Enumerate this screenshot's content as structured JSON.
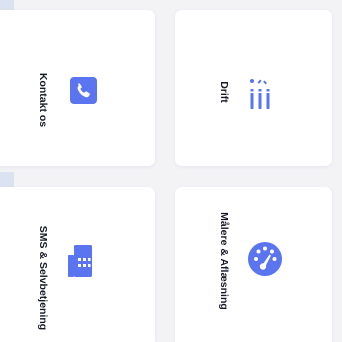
{
  "colors": {
    "accent": "#5b74f0",
    "card_bg": "#ffffff",
    "page_bg": "#f3f3f6",
    "label_text": "#151826"
  },
  "tiles": [
    {
      "label": "Kontakt os",
      "icon": "phone-icon"
    },
    {
      "label": "Drift",
      "icon": "wrench-tools-icon"
    },
    {
      "label": "SMS & Selvbetjening",
      "icon": "building-icon"
    },
    {
      "label": "Målere & Aflæsning",
      "icon": "gauge-meter-icon"
    }
  ]
}
